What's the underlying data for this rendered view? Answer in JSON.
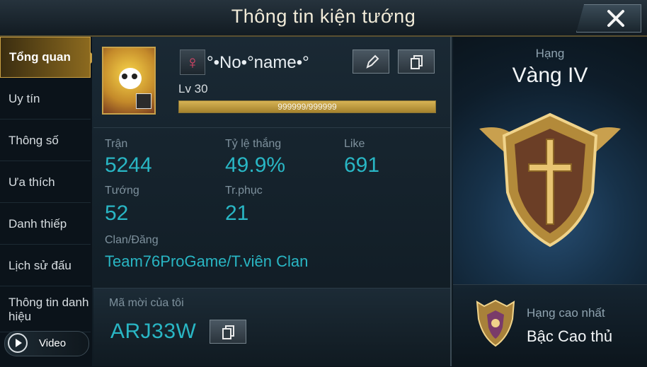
{
  "window": {
    "title": "Thông tin kiện tướng"
  },
  "sidebar": {
    "items": [
      {
        "label": "Tổng quan"
      },
      {
        "label": "Uy tín"
      },
      {
        "label": "Thông số"
      },
      {
        "label": "Ưa thích"
      },
      {
        "label": "Danh thiếp"
      },
      {
        "label": "Lịch sử đấu"
      },
      {
        "label": "Thông tin danh hiệu"
      }
    ],
    "video_label": "Video"
  },
  "profile": {
    "gender_symbol": "♀",
    "name": "°•No•°name•°",
    "level": "Lv 30",
    "xp_text": "999999/999999",
    "xp_fraction": 1.0
  },
  "stats": {
    "matches_label": "Trận",
    "matches": "5244",
    "winrate_label": "Tỷ lệ thắng",
    "winrate": "49.9%",
    "like_label": "Like",
    "like": "691",
    "heroes_label": "Tướng",
    "heroes": "52",
    "skins_label": "Tr.phục",
    "skins": "21",
    "clan_label": "Clan/Đăng",
    "clan": "Team76ProGame/T.viên Clan"
  },
  "invite": {
    "label": "Mã mời của tôi",
    "code": "ARJ33W"
  },
  "rank": {
    "label": "Hạng",
    "name": "Vàng IV",
    "best_label": "Hạng cao nhất",
    "best_name": "Bậc Cao thủ"
  },
  "colors": {
    "accent": "#29b6c4",
    "gold": "#c8a24a"
  }
}
